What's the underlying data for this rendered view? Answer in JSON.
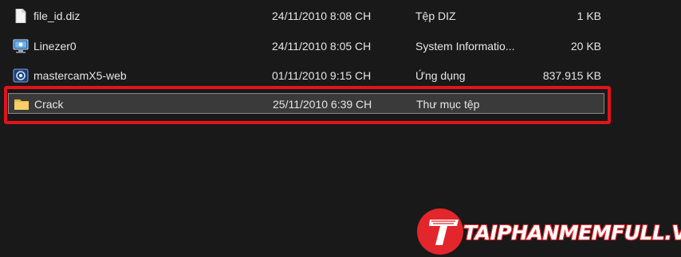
{
  "files": [
    {
      "name": "file_id.diz",
      "date": "24/11/2010 8:08 CH",
      "type": "Tệp DIZ",
      "size": "1 KB",
      "icon": "text-file-icon"
    },
    {
      "name": "Linezer0",
      "date": "24/11/2010 8:05 CH",
      "type": "System Informatio...",
      "size": "20 KB",
      "icon": "system-info-icon"
    },
    {
      "name": "mastercamX5-web",
      "date": "01/11/2010 9:15 CH",
      "type": "Ứng dụng",
      "size": "837.915 KB",
      "icon": "application-icon"
    },
    {
      "name": "Crack",
      "date": "25/11/2010 6:39 CH",
      "type": "Thư mục tệp",
      "size": "",
      "icon": "folder-icon",
      "selected": true
    }
  ],
  "watermark": {
    "text": "TAIPHANMEMFULL.VN",
    "accent": "#e3262b"
  },
  "colors": {
    "background": "#191919",
    "text": "#e6e6e6",
    "highlight": "#e3131a"
  }
}
